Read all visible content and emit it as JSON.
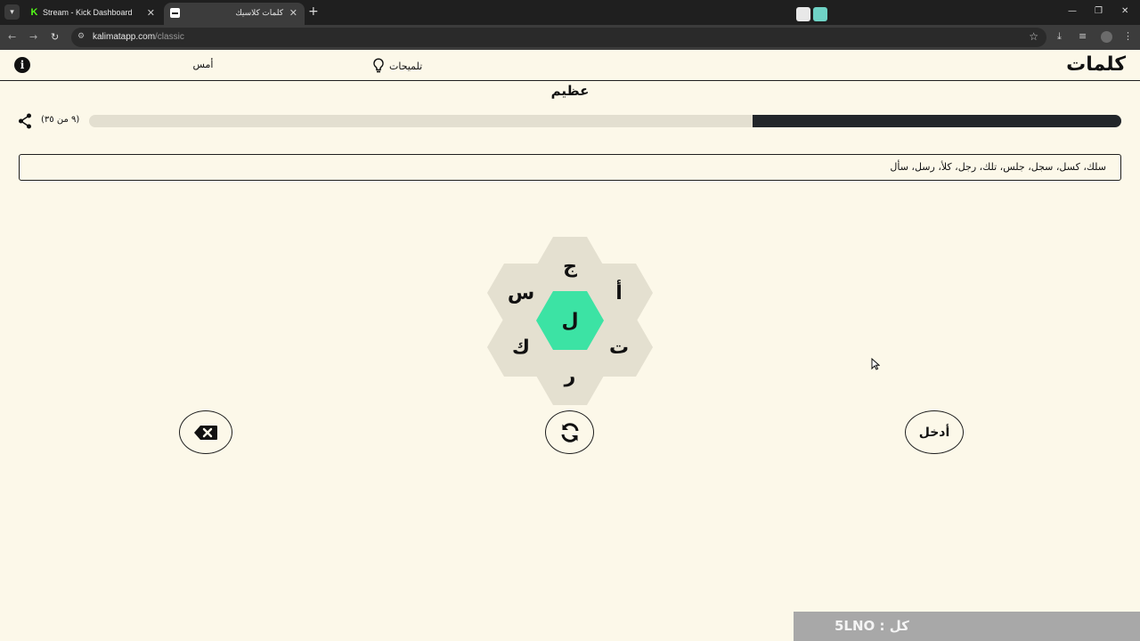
{
  "browser": {
    "tabs": [
      {
        "title": "Stream - Kick Dashboard",
        "active": false,
        "favicon": "kick-icon"
      },
      {
        "title": "كلمات كلاسيك",
        "active": true,
        "favicon": "kalimat-icon"
      }
    ],
    "url_host": "kalimatapp.com",
    "url_path": "/classic"
  },
  "app": {
    "logo": "كلمات",
    "hints_label": "تلميحات",
    "yesterday_label": "أمس"
  },
  "game": {
    "rank": "عظيم",
    "count_label": "(٩ من ٣٥)",
    "progress_fraction": 0.357,
    "found_words": "سلك، كسل، سجل، جلس، تلك، رجل، كلأ، رسل، سأل",
    "center_letter": "ل",
    "outer_letters": [
      "ج",
      "أ",
      "ت",
      "ر",
      "ك",
      "س"
    ],
    "enter_label": "أدخل"
  },
  "overlay": {
    "text": "كل : 5LNO"
  },
  "colors": {
    "background": "#fcf8e9",
    "center_cell": "#3ce3a4",
    "outer_cell": "#e4e0d0",
    "progress_fill": "#22262a",
    "progress_track": "#e3dfd0"
  }
}
